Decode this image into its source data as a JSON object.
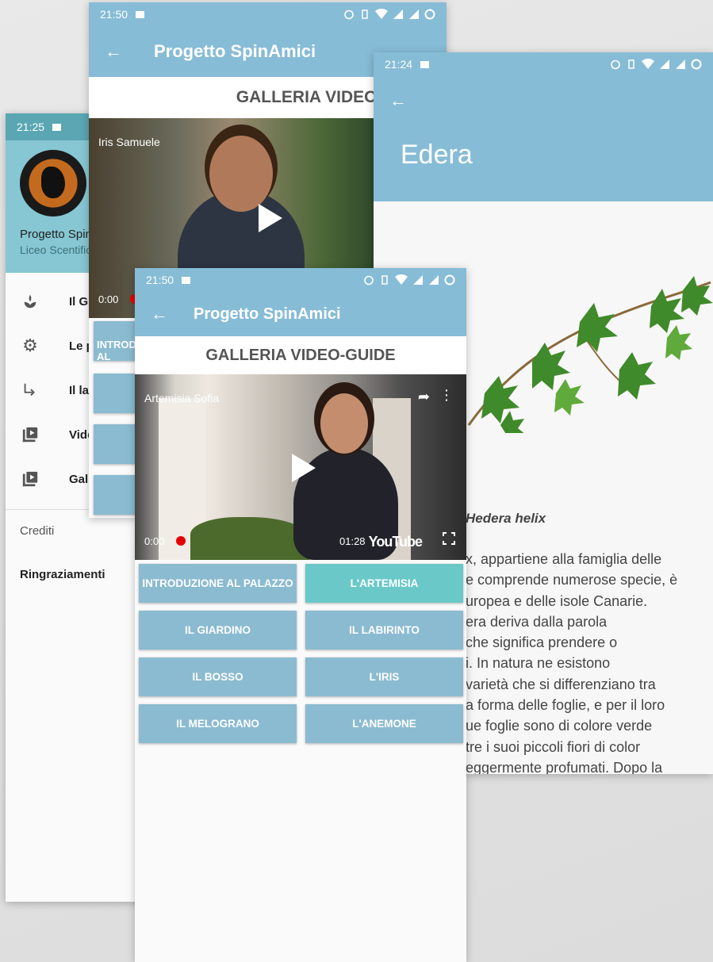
{
  "drawer": {
    "time": "21:25",
    "app_name": "Progetto SpinAmici",
    "school": "Liceo Scentifico",
    "items": [
      {
        "label": "Il Giardino",
        "icon": "plant-icon"
      },
      {
        "label": "Le piante",
        "icon": "gear-icon"
      },
      {
        "label": "Il labirinto",
        "icon": "arrow-turn-icon"
      },
      {
        "label": "Video",
        "icon": "video-library-icon"
      },
      {
        "label": "Galleria",
        "icon": "video-library-icon"
      }
    ],
    "section": "Crediti",
    "link": "Ringraziamenti"
  },
  "gallery_back": {
    "time": "21:50",
    "title": "Progetto SpinAmici",
    "gallery_title": "GALLERIA VIDEO-GUIDE",
    "video_names": "Iris  Samuele",
    "current_time": "0:00",
    "buttons": [
      "INTRODUZIONE AL PALAZZO",
      "",
      "",
      ""
    ]
  },
  "edera": {
    "time": "21:24",
    "title": "Edera",
    "latin": "Hedera helix",
    "text": "x, appartiene alla famiglia delle\ne comprende numerose specie, è\nuropea e delle isole Canarie.\nera deriva dalla parola\n che significa prendere o\ni. In natura ne esistono\n varietà che si differenziano tra\na forma delle foglie,  e per il loro\nue foglie sono di colore verde\ntre i suoi piccoli fiori di color\neggermente profumati. Dopo la"
  },
  "gallery_front": {
    "time": "21:50",
    "title": "Progetto SpinAmici",
    "gallery_title": "GALLERIA VIDEO-GUIDE",
    "video_names": "Artemisia  Sofia",
    "current_time": "0:00",
    "duration": "01:28",
    "youtube_label": "YouTube",
    "buttons": [
      {
        "label": "INTRODUZIONE AL PALAZZO",
        "active": false
      },
      {
        "label": "L'ARTEMISIA",
        "active": true
      },
      {
        "label": "IL GIARDINO",
        "active": false
      },
      {
        "label": "IL LABIRINTO",
        "active": false
      },
      {
        "label": "IL BOSSO",
        "active": false
      },
      {
        "label": "L'IRIS",
        "active": false
      },
      {
        "label": "IL MELOGRANO",
        "active": false
      },
      {
        "label": "L'ANEMONE",
        "active": false
      }
    ]
  },
  "colors": {
    "appbar": "#87bcd6",
    "drawer_status": "#5aa7b3",
    "drawer_header": "#86c7d3",
    "button": "#8bbbd1",
    "button_active": "#6ac8c8",
    "progress_dot": "#e50000"
  }
}
